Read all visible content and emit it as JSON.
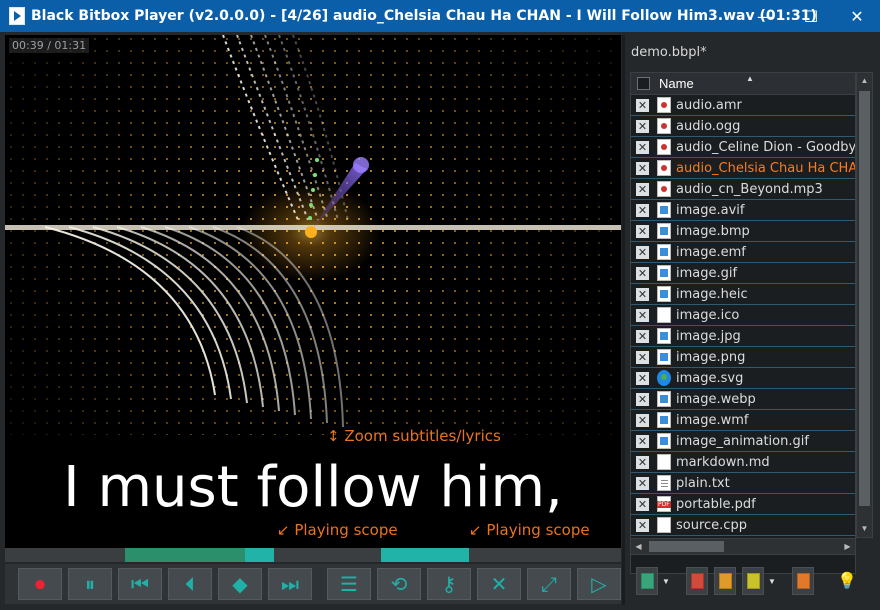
{
  "window": {
    "title": "Black Bitbox Player (v2.0.0.0) - [4/26] audio_Chelsia Chau Ha CHAN - I Will Follow Him3.wav (01:31)",
    "minimize_glyph": "—",
    "maximize_glyph": "☐",
    "close_glyph": "✕"
  },
  "video": {
    "timecode": "00:39 / 01:31",
    "lyric": "I must follow him,",
    "annotations": {
      "zoom": "Zoom subtitles/lyrics",
      "scope_left": "Playing scope",
      "scope_right": "Playing scope"
    },
    "accent_color": "#e8731f"
  },
  "progress": {
    "played_fraction": 0.43,
    "segments": [
      {
        "start": 0.195,
        "end": 0.39,
        "color": "#2a8f6a"
      },
      {
        "start": 0.39,
        "end": 0.437,
        "color": "#22b3a8"
      },
      {
        "start": 0.61,
        "end": 0.753,
        "color": "#22b3a8"
      }
    ]
  },
  "toolbar": {
    "icons": [
      "record-icon",
      "pause-icon",
      "previous-icon",
      "skip-back-icon",
      "stop-icon",
      "skip-forward-icon",
      "playlist-icon",
      "repeat-icon",
      "key-icon",
      "mute-icon",
      "fullscreen-icon",
      "panel-toggle-icon"
    ]
  },
  "playlist": {
    "title": "demo.bbpl*",
    "column_name": "Name",
    "remove_glyph": "✕",
    "items": [
      {
        "name": "audio.amr",
        "icon": "audio"
      },
      {
        "name": "audio.ogg",
        "icon": "audio"
      },
      {
        "name": "audio_Celine Dion - Goodbye's (",
        "icon": "audio"
      },
      {
        "name": "audio_Chelsia Chau Ha CHAN -",
        "icon": "audio"
      },
      {
        "name": "audio_cn_Beyond.mp3",
        "icon": "audio"
      },
      {
        "name": "image.avif",
        "icon": "image"
      },
      {
        "name": "image.bmp",
        "icon": "image"
      },
      {
        "name": "image.emf",
        "icon": "image"
      },
      {
        "name": "image.gif",
        "icon": "image"
      },
      {
        "name": "image.heic",
        "icon": "image"
      },
      {
        "name": "image.ico",
        "icon": "blank"
      },
      {
        "name": "image.jpg",
        "icon": "image"
      },
      {
        "name": "image.png",
        "icon": "image"
      },
      {
        "name": "image.svg",
        "icon": "edge"
      },
      {
        "name": "image.webp",
        "icon": "image"
      },
      {
        "name": "image.wmf",
        "icon": "image"
      },
      {
        "name": "image_animation.gif",
        "icon": "image"
      },
      {
        "name": "markdown.md",
        "icon": "blank"
      },
      {
        "name": "plain.txt",
        "icon": "text"
      },
      {
        "name": "portable.pdf",
        "icon": "pdf"
      },
      {
        "name": "source.cpp",
        "icon": "blank"
      }
    ],
    "active_index": 3,
    "active_color": "#ff7a1a"
  }
}
